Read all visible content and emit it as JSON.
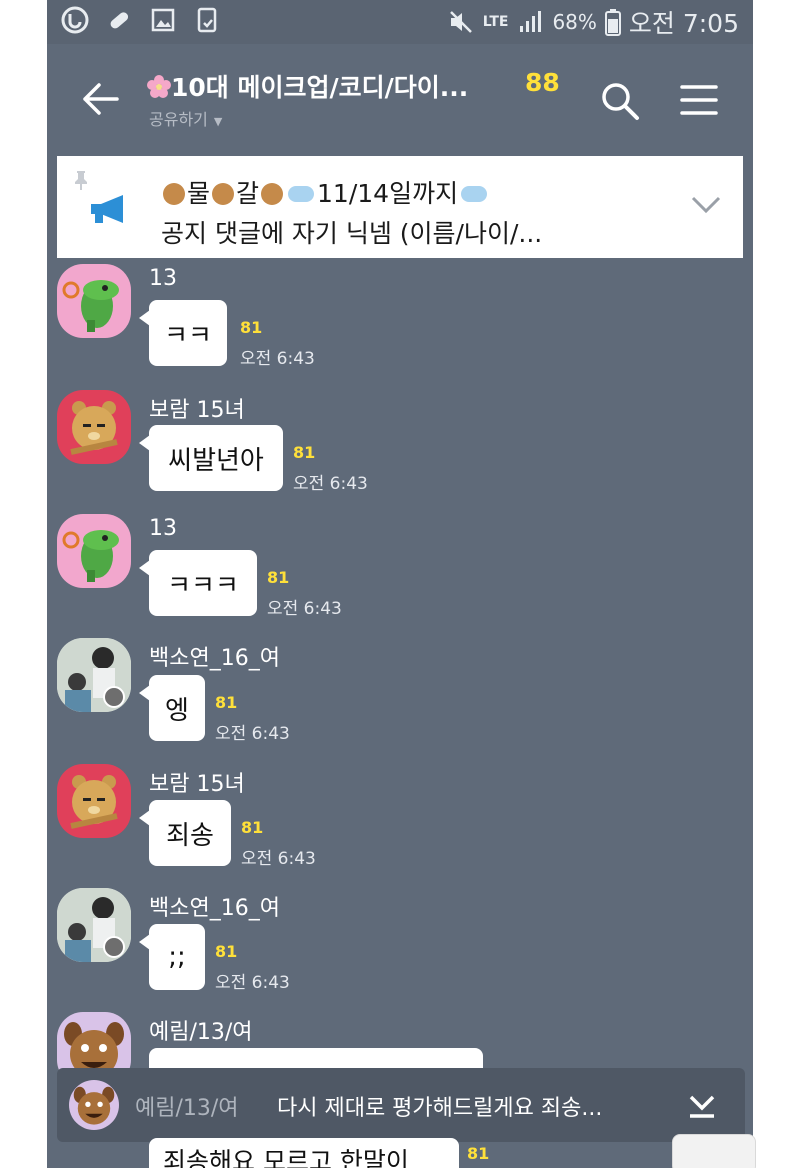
{
  "status_bar": {
    "lte": "LTE",
    "battery": "68%",
    "clock": "오전 7:05",
    "icons": [
      "u-plus-icon",
      "pill-icon",
      "gallery-icon",
      "download-icon",
      "mute-icon",
      "signal-icon",
      "battery-icon"
    ]
  },
  "header": {
    "title": "10대 메이크업/코디/다이...",
    "member_count": "88",
    "share_label": "공유하기",
    "icons": [
      "back-arrow-icon",
      "cherry-blossom-icon",
      "search-icon",
      "menu-icon"
    ]
  },
  "notice": {
    "line1_parts": [
      "물",
      "갈",
      "11/14일까지"
    ],
    "line2": "공지 댓글에 자기 닉넴 (이름/나이/...",
    "icons": [
      "pin-icon",
      "megaphone-icon",
      "monkey-emoji-icon",
      "cloud-emoji-icon",
      "chevron-down-icon"
    ]
  },
  "messages": [
    {
      "sender": "13",
      "text": "ㅋㅋ",
      "unread": "81",
      "time": "오전 6:43",
      "avatar": "green-crocodile"
    },
    {
      "sender": "보람 15녀",
      "text": "씨발년아",
      "unread": "81",
      "time": "오전 6:43",
      "avatar": "ryan-bear"
    },
    {
      "sender": "13",
      "text": "ㅋㅋㅋ",
      "unread": "81",
      "time": "오전 6:43",
      "avatar": "green-crocodile"
    },
    {
      "sender": "백소연_16_여",
      "text": "엥",
      "unread": "81",
      "time": "오전 6:43",
      "avatar": "photo"
    },
    {
      "sender": "보람 15녀",
      "text": "죄송",
      "unread": "81",
      "time": "오전 6:43",
      "avatar": "ryan-bear"
    },
    {
      "sender": "백소연_16_여",
      "text": ";;",
      "unread": "81",
      "time": "오전 6:43",
      "avatar": "photo"
    },
    {
      "sender": "예림/13/여",
      "text": "",
      "unread": "",
      "time": "",
      "avatar": "brown-dog"
    }
  ],
  "preview": {
    "sender": "예림/13/여",
    "text": "다시 제대로 평가해드릴게요 죄송...",
    "icons": [
      "brown-dog-avatar",
      "scroll-down-icon"
    ]
  },
  "partial_message": {
    "text": "죄송해요 모르고 한말이",
    "unread": "81"
  },
  "colors": {
    "chat_bg": "#5f6a79",
    "unread": "#ffe03a",
    "bubble": "#ffffff"
  }
}
